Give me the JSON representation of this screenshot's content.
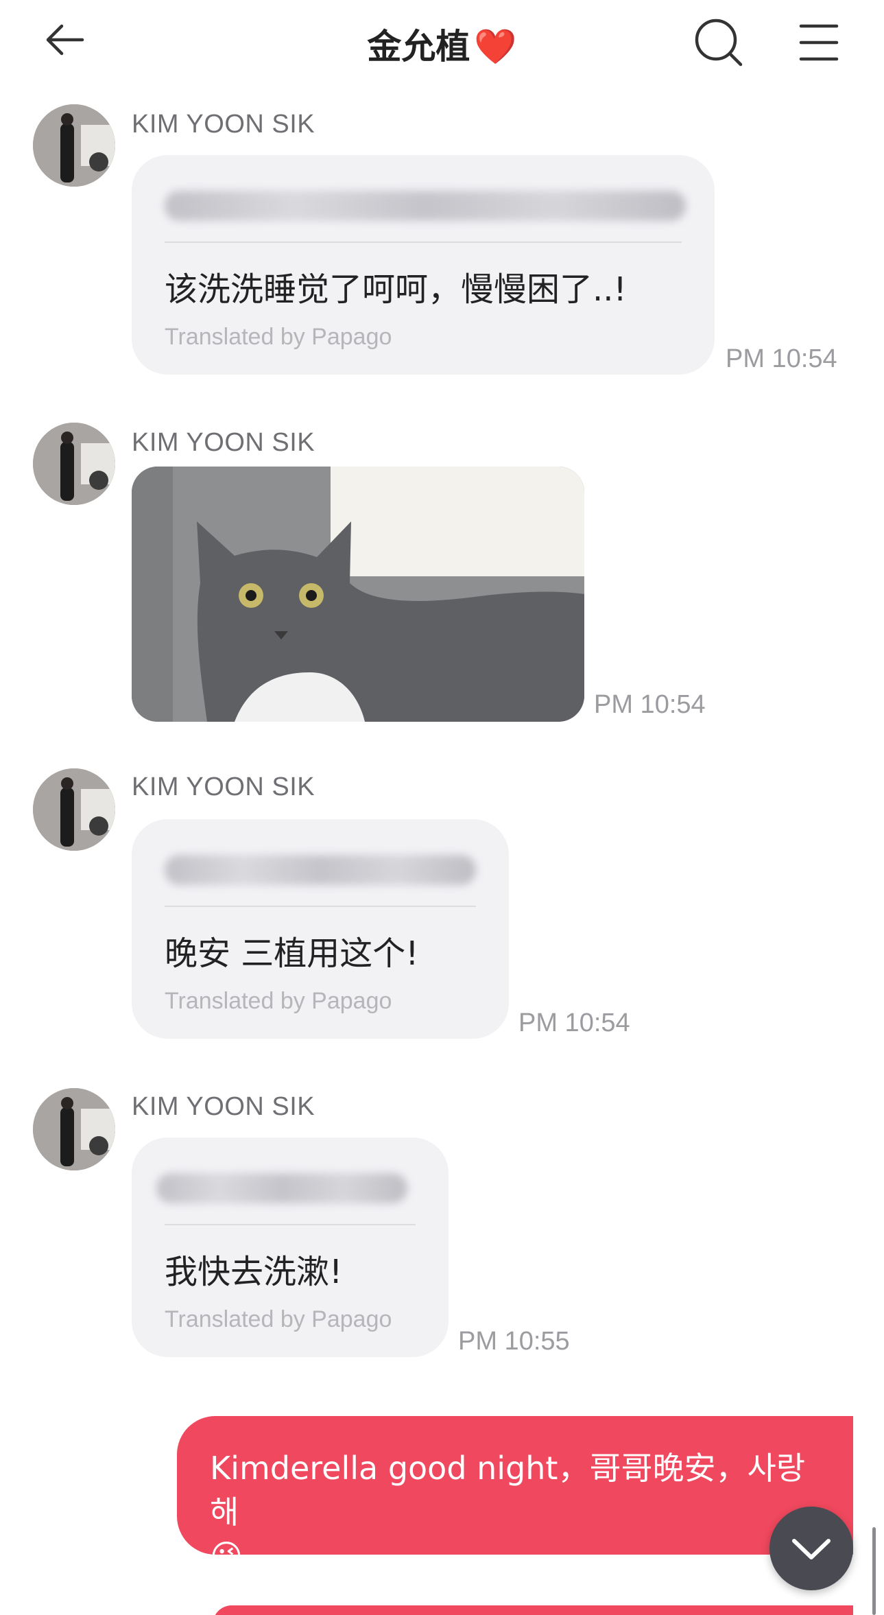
{
  "header": {
    "title": "金允植",
    "title_emoji": "❤️",
    "back_icon": "arrow-left-icon",
    "search_icon": "search-icon",
    "menu_icon": "hamburger-menu-icon"
  },
  "messages": [
    {
      "sender": "KIM YOON SIK",
      "type": "text",
      "translated_text": "该洗洗睡觉了呵呵，慢慢困了..!",
      "translation_credit": "Translated by Papago",
      "time": "PM 10:54"
    },
    {
      "sender": "KIM YOON SIK",
      "type": "image",
      "image_description": "grey cat photo",
      "time": "PM 10:54"
    },
    {
      "sender": "KIM YOON SIK",
      "type": "text",
      "translated_text": "晚安 三植用这个!",
      "translation_credit": "Translated by Papago",
      "time": "PM 10:54"
    },
    {
      "sender": "KIM YOON SIK",
      "type": "text",
      "translated_text": "我快去洗漱!",
      "translation_credit": "Translated by Papago",
      "time": "PM 10:55"
    }
  ],
  "outgoing": {
    "text": "Kimderella good night，哥哥晚安，사랑해",
    "emoji": "😘",
    "bubble_color": "#f0485e"
  },
  "scroll_down_icon": "chevron-down-icon",
  "colors": {
    "incoming_bubble": "#f2f2f5",
    "outgoing_bubble": "#f0485e",
    "scroll_button": "#4a4b52"
  }
}
